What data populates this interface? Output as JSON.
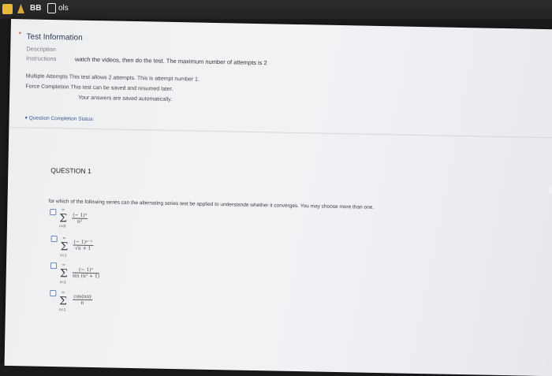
{
  "browser": {
    "tabs": [
      {
        "label": "BB"
      },
      {
        "label": "ols"
      }
    ]
  },
  "test_info": {
    "heading": "Test Information",
    "description_label": "Description",
    "instructions_label": "Instructions",
    "instructions_value": "watch the videos, then do the test. The maximum number of attempts is 2",
    "multiple_attempts": "Multiple Attempts This test allows 2 attempts. This is attempt number 1.",
    "force_completion": "Force Completion This test can be saved and resumed later.",
    "autosave": "Your answers are saved automatically.",
    "completion_status": "▾ Question Completion Status:"
  },
  "question": {
    "heading": "QUESTION 1",
    "text": "for which of the following series can the alternating series test be applied to understande whether it converges. You may choose more than one.",
    "options": [
      {
        "sum_from": "n=0",
        "sum_to": "∞",
        "numerator": "(− 1)ⁿ",
        "denominator": "n²"
      },
      {
        "sum_from": "n=1",
        "sum_to": "∞",
        "numerator": "(− 1)ⁿ⁻¹",
        "denominator": "√n + 1"
      },
      {
        "sum_from": "n=1",
        "sum_to": "∞",
        "numerator": "(− 1)ⁿ",
        "denominator": "sin (n² + 1)"
      },
      {
        "sum_from": "n=1",
        "sum_to": "∞",
        "numerator": "cos(nπ)",
        "denominator": "n"
      }
    ]
  }
}
